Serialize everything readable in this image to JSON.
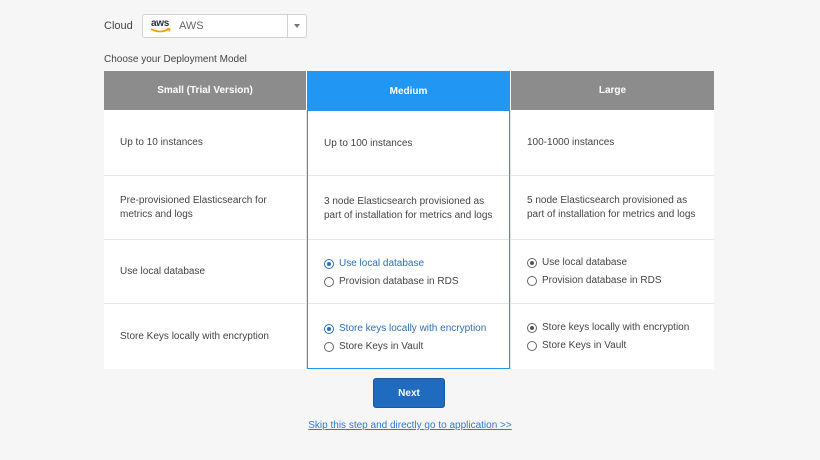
{
  "cloud": {
    "label": "Cloud",
    "selected_value": "AWS",
    "logo_text": "aws"
  },
  "deployment_label": "Choose your Deployment Model",
  "models": [
    {
      "name": "Small (Trial Version)",
      "instances": "Up to 10 instances",
      "elasticsearch": "Pre-provisioned Elasticsearch for metrics and logs",
      "database_text": "Use local database",
      "keys_text": "Store Keys locally with encryption"
    },
    {
      "name": "Medium",
      "selected": true,
      "instances": "Up to 100 instances",
      "elasticsearch": "3 node Elasticsearch provisioned as part of installation for metrics and logs",
      "database_options": [
        "Use local database",
        "Provision database in RDS"
      ],
      "keys_options": [
        "Store keys locally with encryption",
        "Store Keys in Vault"
      ]
    },
    {
      "name": "Large",
      "instances": "100-1000 instances",
      "elasticsearch": "5 node Elasticsearch provisioned as part of installation for metrics and logs",
      "database_options": [
        "Use local database",
        "Provision database in RDS"
      ],
      "keys_options": [
        "Store keys locally with encryption",
        "Store Keys in Vault"
      ]
    }
  ],
  "next_label": "Next",
  "skip_link": "Skip this step and directly go to application >>",
  "colors": {
    "selected_header": "#2196f3",
    "header": "#8c8c8c",
    "button": "#1f6bbf",
    "link": "#2b7bd0"
  }
}
